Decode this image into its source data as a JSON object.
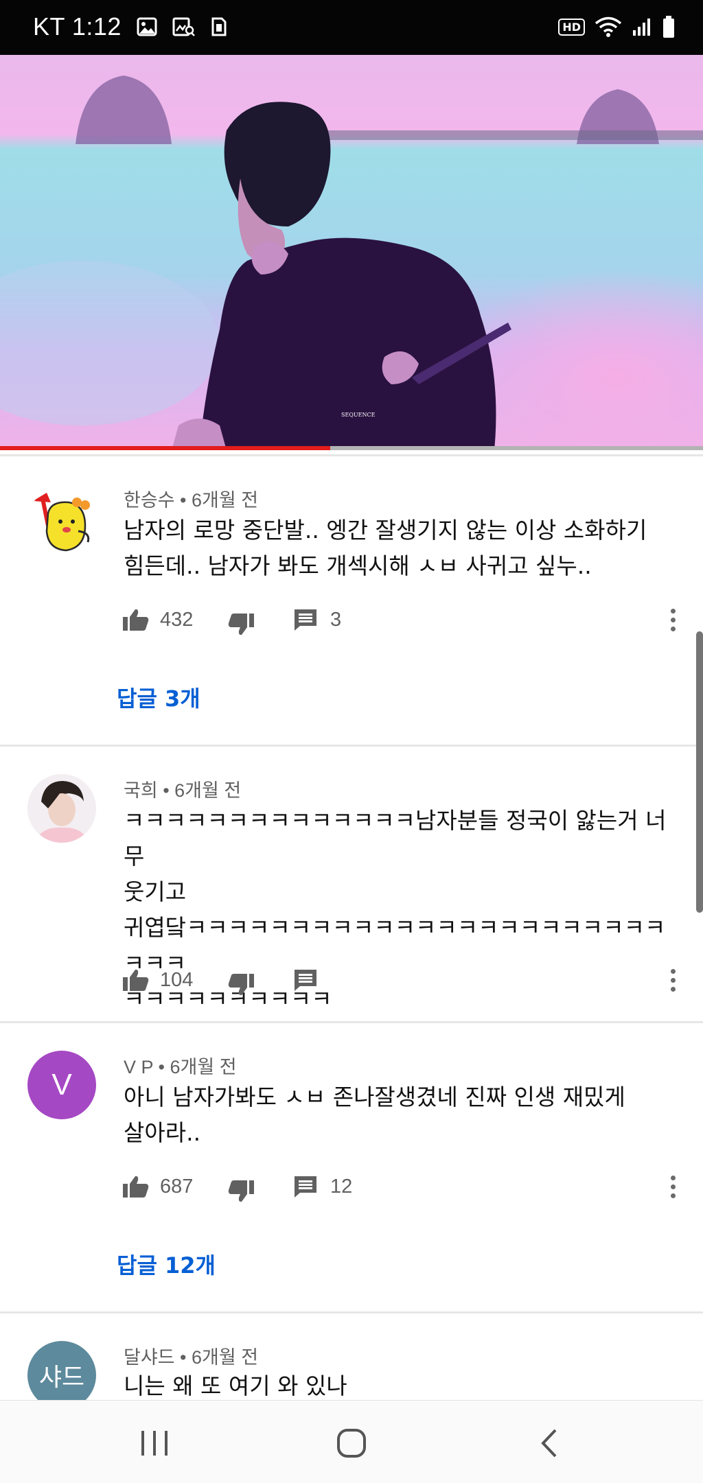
{
  "status_bar": {
    "carrier_time": "KT 1:12",
    "icons": [
      "gallery-icon",
      "screenshot-search-icon",
      "sim-card-icon",
      "hd-badge",
      "wifi-icon",
      "signal-icon",
      "battery-icon"
    ],
    "hd_label": "HD"
  },
  "video": {
    "watermark": "SEQUENCE",
    "progress_fraction": 0.47,
    "colors": {
      "progress": "#e31c1c",
      "track": "#b3b3b3"
    }
  },
  "comments": [
    {
      "author": "한승수",
      "time": "6개월 전",
      "lines": [
        "남자의 로망 중단발..  엥간 잘생기지 않는 이상 소화하기",
        "힘든데.. 남자가 봐도 개섹시해 ㅅㅂ 사귀고 싶누.."
      ],
      "likes": "432",
      "reply_count": "3",
      "replies_link": "답글 3개",
      "avatar": "yellow-character-sticker"
    },
    {
      "author": "국희",
      "time": "6개월 전",
      "lines": [
        "ㅋㅋㅋㅋㅋㅋㅋㅋㅋㅋㅋㅋㅋㅋ남자분들 정국이 앓는거 너무",
        "웃기고",
        "귀엽닼ㅋㅋㅋㅋㅋㅋㅋㅋㅋㅋㅋㅋㅋㅋㅋㅋㅋㅋㅋㅋㅋㅋㅋㅋㅋㅋ",
        "ㅋㅋㅋㅋㅋㅋㅋㅋㅋㅋ"
      ],
      "likes": "104",
      "reply_count": "",
      "replies_link": "",
      "avatar": "photo"
    },
    {
      "author": "V P",
      "time": "6개월 전",
      "lines": [
        "아니 남자가봐도 ㅅㅂ 존나잘생겼네 진짜 인생 재밌게",
        "살아라.."
      ],
      "likes": "687",
      "reply_count": "12",
      "replies_link": "답글 12개",
      "avatar_letter": "V",
      "avatar_color": "#a548c4"
    },
    {
      "author": "달샤드",
      "time": "6개월 전",
      "lines": [
        "니는 왜 또 여기 와 있나"
      ],
      "avatar_letter": "샤드",
      "avatar_color": "#5d8a9c"
    }
  ],
  "nav_bar": {
    "buttons": [
      "recent-apps-icon",
      "home-icon",
      "back-icon"
    ]
  },
  "colors": {
    "link": "#065fd4",
    "meta": "#606060"
  }
}
